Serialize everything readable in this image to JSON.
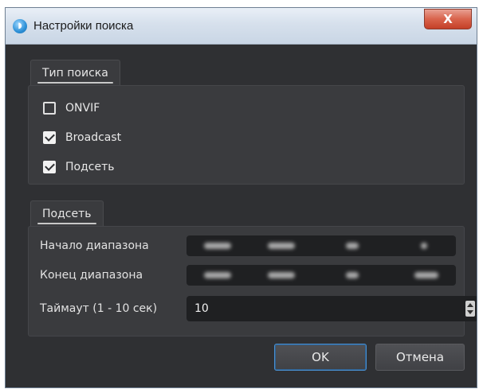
{
  "window": {
    "title": "Настройки поиска",
    "close_glyph": "X",
    "app_icon": "chat-bubble-icon"
  },
  "search_type": {
    "tab_label": "Тип поиска",
    "options": [
      {
        "label": "ONVIF",
        "checked": false
      },
      {
        "label": "Broadcast",
        "checked": true
      },
      {
        "label": "Подсеть",
        "checked": true
      }
    ]
  },
  "subnet": {
    "tab_label": "Подсеть",
    "range_start_label": "Начало диапазона",
    "range_end_label": "Конец диапазона",
    "timeout_label": "Таймаут (1 - 10 сек)",
    "timeout_value": "10"
  },
  "buttons": {
    "ok": "OK",
    "cancel": "Отмена"
  },
  "colors": {
    "background": "#2f3033",
    "panel": "#3a3b3e",
    "field": "#1f2022",
    "accent": "#4a90d0",
    "close": "#d9634c"
  }
}
